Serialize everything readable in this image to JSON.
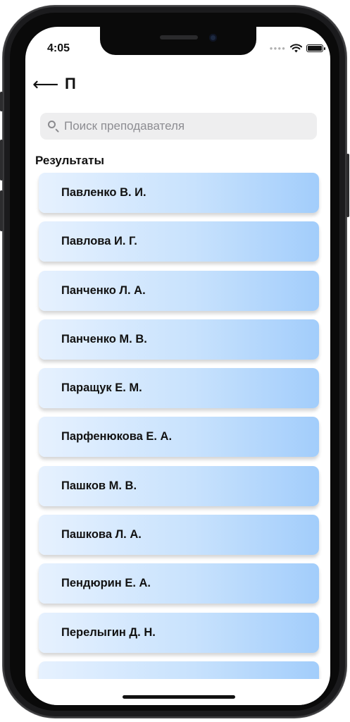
{
  "status_bar": {
    "time": "4:05"
  },
  "nav": {
    "back_icon": "arrow-left-icon",
    "title": "П"
  },
  "search": {
    "placeholder": "Поиск преподавателя",
    "value": ""
  },
  "results": {
    "label": "Результаты",
    "items": [
      "Павленко В. И.",
      "Павлова И. Г.",
      "Панченко Л. А.",
      "Панченко М. В.",
      "Паращук Е. М.",
      "Парфенюкова Е. А.",
      "Пашков М. В.",
      "Пашкова Л. А.",
      "Пендюрин Е. А.",
      "Перелыгин Д. Н.",
      ""
    ]
  },
  "colors": {
    "card_gradient_start": "#e6f1fe",
    "card_gradient_end": "#a2cdfb",
    "search_background": "#eeeeef"
  }
}
